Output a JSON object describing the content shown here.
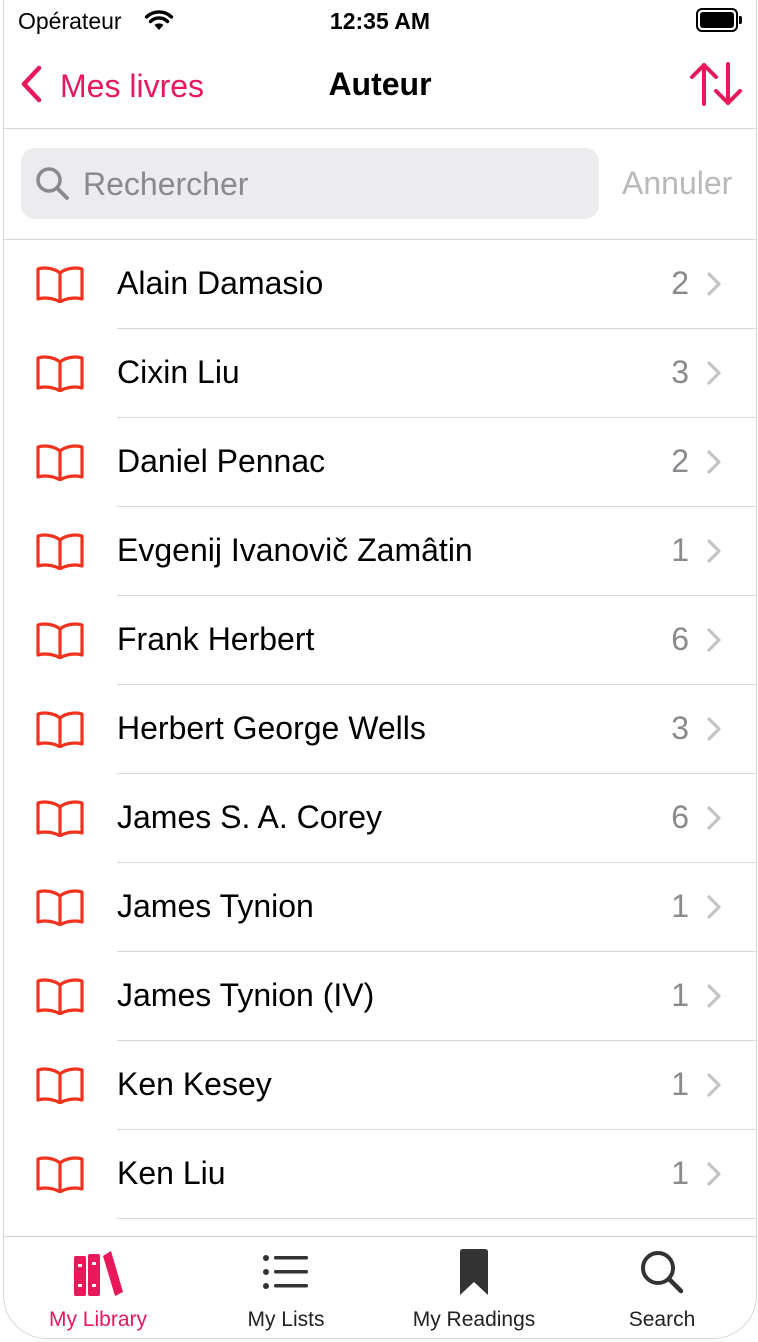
{
  "status_bar": {
    "carrier": "Opérateur",
    "time": "12:35 AM"
  },
  "nav": {
    "back_label": "Mes livres",
    "title": "Auteur"
  },
  "search": {
    "placeholder": "Rechercher",
    "cancel_label": "Annuler"
  },
  "authors": [
    {
      "name": "Alain Damasio",
      "count": "2"
    },
    {
      "name": "Cixin Liu",
      "count": "3"
    },
    {
      "name": "Daniel Pennac",
      "count": "2"
    },
    {
      "name": "Evgenij Ivanovič Zamâtin",
      "count": "1"
    },
    {
      "name": "Frank Herbert",
      "count": "6"
    },
    {
      "name": "Herbert George Wells",
      "count": "3"
    },
    {
      "name": "James S. A. Corey",
      "count": "6"
    },
    {
      "name": "James Tynion",
      "count": "1"
    },
    {
      "name": "James Tynion (IV)",
      "count": "1"
    },
    {
      "name": "Ken Kesey",
      "count": "1"
    },
    {
      "name": "Ken Liu",
      "count": "1"
    }
  ],
  "tabs": [
    {
      "label": "My Library",
      "icon": "library-icon",
      "active": true
    },
    {
      "label": "My Lists",
      "icon": "list-icon",
      "active": false
    },
    {
      "label": "My Readings",
      "icon": "bookmark-icon",
      "active": false
    },
    {
      "label": "Search",
      "icon": "search-icon",
      "active": false
    }
  ],
  "colors": {
    "accent": "#e8185a",
    "book_icon": "#f0321e",
    "secondary_text": "#8a8a8e"
  }
}
